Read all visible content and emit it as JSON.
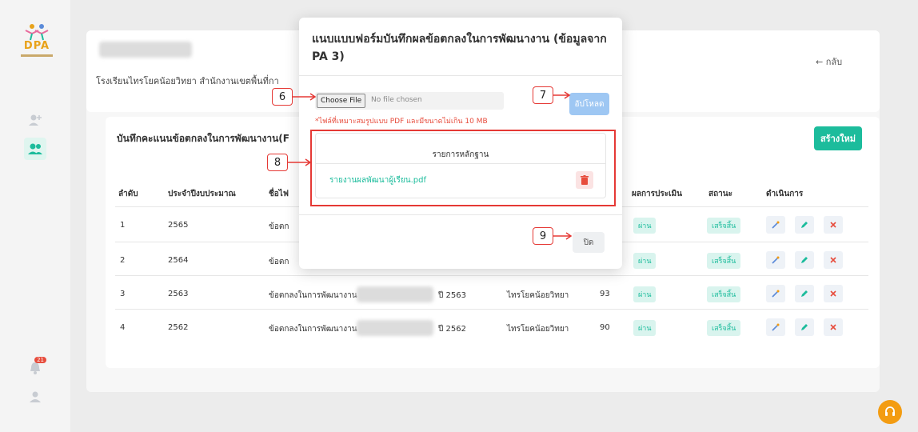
{
  "sidebar": {
    "logo_text": "DPA",
    "notification_count": "21"
  },
  "header": {
    "school_line": "โรงเรียนไทรโยคน้อยวิทยา สำนักงานเขตพื้นที่กา",
    "back_label": "← กลับ"
  },
  "table_card": {
    "title": "บันทึกคะแนนข้อตกลงในการพัฒนางาน(F",
    "create_label": "สร้างใหม่",
    "columns": [
      "ลำดับ",
      "ประจำปีงบประมาณ",
      "ชื่อไฟ",
      "ผลการประเมิน",
      "สถานะ",
      "ดำเนินการ"
    ],
    "rows": [
      {
        "no": "1",
        "year": "2565",
        "name": "ข้อตก",
        "school": "",
        "score": "",
        "result": "ผ่าน",
        "status": "เสร็จสิ้น"
      },
      {
        "no": "2",
        "year": "2564",
        "name": "ข้อตก",
        "school": "",
        "score": "",
        "result": "ผ่าน",
        "status": "เสร็จสิ้น"
      },
      {
        "no": "3",
        "year": "2563",
        "name": "ข้อตกลงในการพัฒนางาน",
        "year_suffix": "ปี 2563",
        "school": "ไทรโยคน้อยวิทยา",
        "score": "93",
        "result": "ผ่าน",
        "status": "เสร็จสิ้น"
      },
      {
        "no": "4",
        "year": "2562",
        "name": "ข้อตกลงในการพัฒนางาน",
        "year_suffix": "ปี 2562",
        "school": "ไทรโยคน้อยวิทยา",
        "score": "90",
        "result": "ผ่าน",
        "status": "เสร็จสิ้น"
      }
    ]
  },
  "modal": {
    "title": "แนบแบบฟอร์มบันทึกผลข้อตกลงในการพัฒนางาน (ข้อมูลจาก PA 3)",
    "choose_file_label": "Choose File",
    "no_file_label": "No file chosen",
    "upload_label": "อัปโหลด",
    "hint": "*ไฟล์ที่เหมาะสมรูปแบบ PDF และมีขนาดไม่เกิน 10 MB",
    "evidence_header": "รายการหลักฐาน",
    "evidence_file": "รายงานผลพัฒนาผู้เรียน.pdf",
    "close_label": "ปิด"
  },
  "callouts": {
    "c6": "6",
    "c7": "7",
    "c8": "8",
    "c9": "9"
  },
  "colors": {
    "accent": "#1cbc9c",
    "upload": "#9ec7f3",
    "danger": "#e53935",
    "help": "#f39c12"
  }
}
